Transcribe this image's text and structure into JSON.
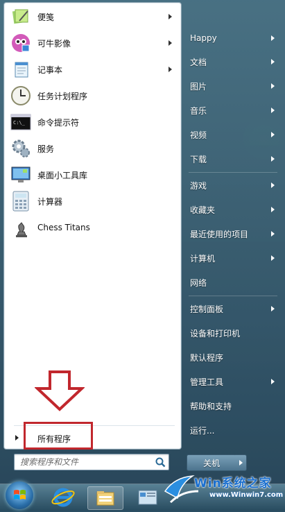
{
  "left_items": [
    {
      "label": "便笺",
      "icon": "sticky-notes-icon",
      "has_arrow": true
    },
    {
      "label": "可牛影像",
      "icon": "keniu-image-icon",
      "has_arrow": true
    },
    {
      "label": "记事本",
      "icon": "notepad-icon",
      "has_arrow": true
    },
    {
      "label": "任务计划程序",
      "icon": "task-scheduler-icon",
      "has_arrow": false
    },
    {
      "label": "命令提示符",
      "icon": "command-prompt-icon",
      "has_arrow": false
    },
    {
      "label": "服务",
      "icon": "services-icon",
      "has_arrow": false
    },
    {
      "label": "桌面小工具库",
      "icon": "gadgets-icon",
      "has_arrow": false
    },
    {
      "label": "计算器",
      "icon": "calculator-icon",
      "has_arrow": false
    },
    {
      "label": "Chess Titans",
      "icon": "chess-icon",
      "has_arrow": false
    }
  ],
  "all_programs": "所有程序",
  "search": {
    "placeholder": "搜索程序和文件"
  },
  "right_items": [
    {
      "label": "Happy",
      "has_arrow": true
    },
    {
      "label": "文档",
      "has_arrow": true
    },
    {
      "label": "图片",
      "has_arrow": true
    },
    {
      "label": "音乐",
      "has_arrow": true
    },
    {
      "label": "视频",
      "has_arrow": true
    },
    {
      "label": "下载",
      "has_arrow": true
    },
    {
      "label": "游戏",
      "has_arrow": true
    },
    {
      "label": "收藏夹",
      "has_arrow": true
    },
    {
      "label": "最近使用的项目",
      "has_arrow": true
    },
    {
      "label": "计算机",
      "has_arrow": true
    },
    {
      "label": "网络",
      "has_arrow": false
    },
    {
      "label": "控制面板",
      "has_arrow": true
    },
    {
      "label": "设备和打印机",
      "has_arrow": false
    },
    {
      "label": "默认程序",
      "has_arrow": false
    },
    {
      "label": "管理工具",
      "has_arrow": true
    },
    {
      "label": "帮助和支持",
      "has_arrow": false
    },
    {
      "label": "运行...",
      "has_arrow": false
    }
  ],
  "shutdown": {
    "label": "关机"
  },
  "watermark": {
    "text": "Win系统之家",
    "url": "www.Winwin7.com"
  },
  "colors": {
    "highlight_box": "#c1272d",
    "arrow": "#c1272d"
  }
}
